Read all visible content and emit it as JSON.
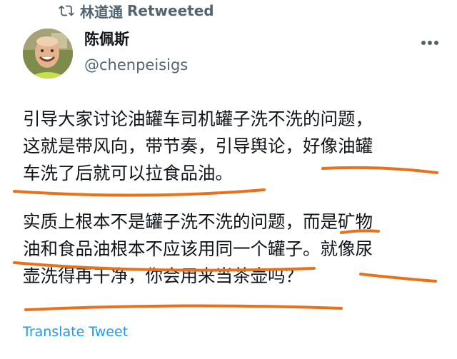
{
  "retweet": {
    "icon": "retweet-icon",
    "name": "林道通",
    "suffix": "Retweeted"
  },
  "author": {
    "display_name": "陈佩斯",
    "handle": "@chenpeisigs",
    "avatar_icon": "avatar"
  },
  "more_icon": "more-options-icon",
  "tweet": {
    "paragraph1": [
      "引导大家讨论油罐车司机罐子洗不洗的问题，",
      "这就是带风向，带节奏，引导舆论，好像油罐",
      "车洗了后就可以拉食品油。"
    ],
    "paragraph2": [
      "实质上根本不是罐子洗不洗的问题，而是矿物",
      "油和食品油根本不应该用同一个罐子。就像尿",
      "壶洗得再干净，你会用来当茶壶吗？"
    ]
  },
  "annotations": {
    "underline_color": "#e8711c"
  },
  "footer": {
    "translate_label": "Translate Tweet"
  }
}
